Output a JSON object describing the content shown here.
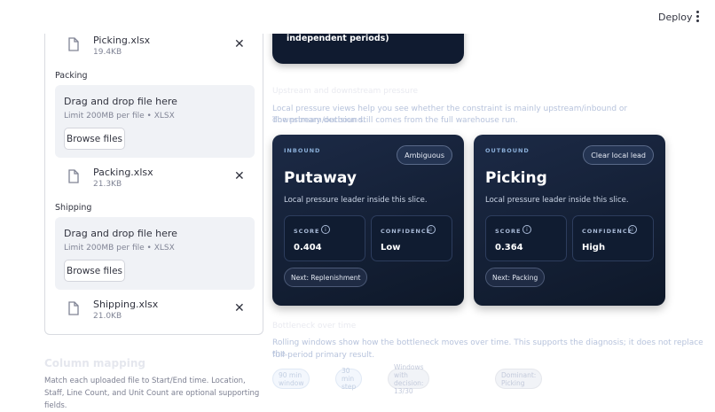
{
  "header": {
    "deploy_label": "Deploy"
  },
  "sidebar": {
    "files": [
      {
        "name": "Picking.xlsx",
        "size": "19.4KB"
      },
      {
        "name": "Packing.xlsx",
        "size": "21.3KB"
      },
      {
        "name": "Shipping.xlsx",
        "size": "21.0KB"
      }
    ],
    "sections": [
      {
        "label": "Packing",
        "drop_title": "Drag and drop file here",
        "drop_sub": "Limit 200MB per file • XLSX",
        "browse": "Browse files"
      },
      {
        "label": "Shipping",
        "drop_title": "Drag and drop file here",
        "drop_sub": "Limit 200MB per file • XLSX",
        "browse": "Browse files"
      }
    ],
    "column_mapping": {
      "title": "Column mapping",
      "text": "Match each uploaded file to Start/End time. Location, Staff, Line Count, and Unit Count are optional supporting fields."
    }
  },
  "main": {
    "top_card_text": "independent periods)",
    "pressure_heading": "Upstream and downstream pressure",
    "pressure_text_1": "Local pressure views help you see whether the constraint is mainly upstream/inbound or downstream/outbound.",
    "pressure_text_2": "The primary decision still comes from the full warehouse run.",
    "cards": [
      {
        "kicker": "INBOUND",
        "pill": "Ambiguous",
        "title": "Putaway",
        "subtitle": "Local pressure leader inside this slice.",
        "score_label": "SCORE",
        "score": "0.404",
        "confidence_label": "CONFIDENCE",
        "confidence": "Low",
        "next": "Next: Replenishment"
      },
      {
        "kicker": "OUTBOUND",
        "pill": "Clear local lead",
        "title": "Picking",
        "subtitle": "Local pressure leader inside this slice.",
        "score_label": "SCORE",
        "score": "0.364",
        "confidence_label": "CONFIDENCE",
        "confidence": "High",
        "next": "Next: Packing"
      }
    ],
    "rolling_heading": "Bottleneck over time",
    "rolling_text_1": "Rolling windows show how the bottleneck moves over time. This supports the diagnosis; it does not replace the",
    "rolling_text_2": "full-period primary result.",
    "chips": [
      "90 min window",
      "30 min step",
      "Windows with decision: 13/30",
      "Dominant: Picking"
    ]
  }
}
